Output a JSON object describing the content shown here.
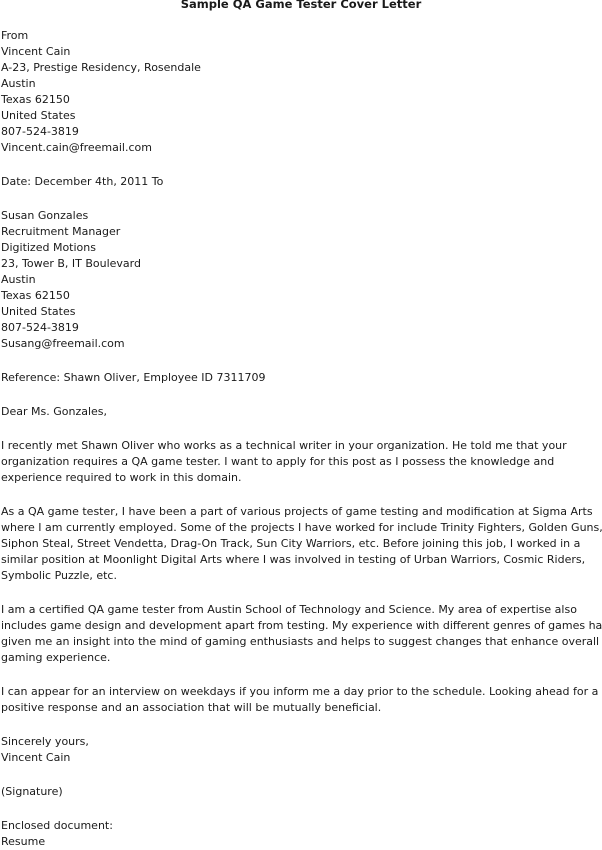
{
  "title": "Sample QA Game Tester Cover Letter",
  "sender": {
    "label": "From",
    "lines": [
      "Vincent Cain",
      "A-23, Prestige Residency, Rosendale",
      "Austin",
      "Texas 62150",
      "United States",
      "807-524-3819",
      "Vincent.cain@freemail.com"
    ]
  },
  "date_line": "Date: December 4th, 2011 To",
  "recipient": {
    "lines": [
      "Susan Gonzales",
      "Recruitment Manager",
      "Digitized Motions",
      "23, Tower B, IT Boulevard",
      "Austin",
      "Texas 62150",
      "United States",
      "807-524-3819",
      "Susang@freemail.com"
    ]
  },
  "reference": "Reference: Shawn Oliver, Employee ID 7311709",
  "salutation": "Dear Ms. Gonzales,",
  "paragraphs": [
    [
      "I recently met Shawn Oliver who works as a technical writer in your organization. He told me that your",
      "organization requires a QA game tester. I want to apply for this post as I possess the knowledge and",
      "experience required to work in this domain."
    ],
    [
      "As a QA game tester, I have been a part of various projects of game testing and modification at Sigma Arts",
      "where I am currently employed. Some of the projects I have worked for include Trinity Fighters, Golden Guns,",
      "Siphon Steal, Street Vendetta, Drag-On Track, Sun City Warriors, etc. Before joining this job, I worked in a",
      "similar position at Moonlight Digital Arts where I was involved in testing of Urban Warriors, Cosmic Riders,",
      "Symbolic Puzzle, etc."
    ],
    [
      "I am a certified QA game tester from Austin School of Technology and Science. My area of expertise also",
      "includes game design and development apart from testing. My experience with different genres of games has",
      "given me an insight into the mind of gaming enthusiasts and helps to suggest changes that enhance overall",
      "gaming experience."
    ],
    [
      "I can appear for an interview on weekdays if you inform me a day prior to the schedule. Looking ahead for a",
      "positive response and an association that will be mutually beneficial."
    ]
  ],
  "closing": {
    "line1": "Sincerely yours,",
    "line2": "Vincent Cain"
  },
  "signature": "(Signature)",
  "enclosure": {
    "label": "Enclosed document:",
    "item": "Resume"
  }
}
